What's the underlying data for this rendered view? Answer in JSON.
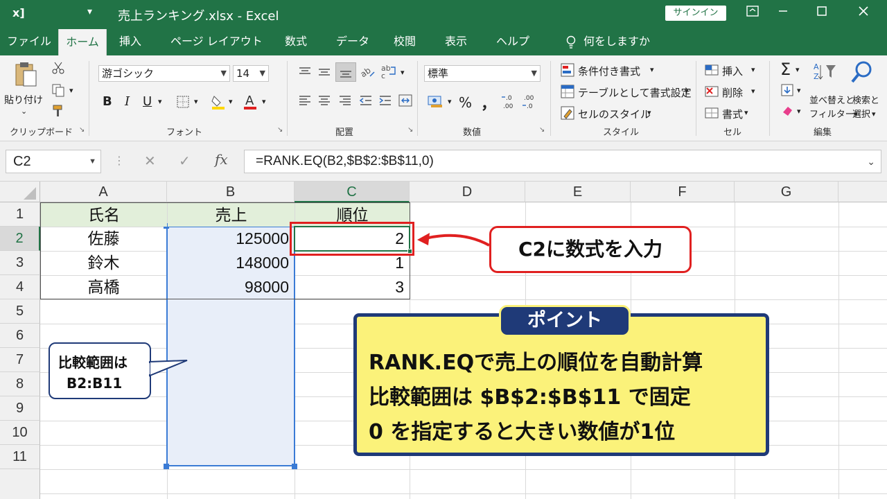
{
  "window": {
    "title": "売上ランキング.xlsx - Excel",
    "signin": "サインイン",
    "qat_glyph": "▾",
    "logo": "x]"
  },
  "tabs": [
    "ファイル",
    "ホーム",
    "挿入",
    "ページ レイアウト",
    "数式",
    "データ",
    "校閲",
    "表示",
    "ヘルプ"
  ],
  "tell_me": "何をしますか",
  "ribbon": {
    "clipboard": {
      "paste": "貼り付け",
      "label": "クリップボード"
    },
    "font": {
      "name": "游ゴシック",
      "size": "14",
      "bold": "B",
      "italic": "I",
      "underline": "U",
      "label": "フォント"
    },
    "alignment": {
      "label": "配置"
    },
    "number": {
      "format": "標準",
      "percent": "%",
      "comma": "，",
      "label": "数値"
    },
    "styles": {
      "conditional": "条件付き書式",
      "table": "テーブルとして書式設定",
      "cell_styles": "セルのスタイル",
      "label": "スタイル"
    },
    "cells": {
      "insert": "挿入",
      "delete": "削除",
      "format": "書式",
      "label": "セル"
    },
    "editing": {
      "sort": "並べ替えと\nフィルター",
      "sort1": "並べ替えと",
      "sort2": "フィルター",
      "find1": "検索と",
      "find2": "選択",
      "label": "編集"
    }
  },
  "formula_bar": {
    "name_box": "C2",
    "cancel": "✕",
    "enter": "✓",
    "fx": "fx",
    "formula": "=RANK.EQ(B2,$B$2:$B$11,0)"
  },
  "columns": [
    "A",
    "B",
    "C",
    "D",
    "E",
    "F",
    "G"
  ],
  "rows": [
    "1",
    "2",
    "3",
    "4",
    "5",
    "6",
    "7",
    "8",
    "9",
    "10",
    "11"
  ],
  "table": {
    "headers": [
      "氏名",
      "売上",
      "順位"
    ],
    "rows": [
      [
        "佐藤",
        "125000",
        "2"
      ],
      [
        "鈴木",
        "148000",
        "1"
      ],
      [
        "高橋",
        "98000",
        "3"
      ]
    ]
  },
  "annotations": {
    "callout": "C2に数式を入力",
    "bubble_line1": "比較範囲は",
    "bubble_line2": "B2:B11",
    "point_title": "ポイント",
    "point_lines": [
      "RANK.EQで売上の順位を自動計算",
      "比較範囲は $B$2:$B$11 で固定",
      "0 を指定すると大きい数値が1位"
    ]
  },
  "colors": {
    "excel_green": "#217346",
    "header_fill": "#e2efda",
    "range_fill": "#e8eef9",
    "range_border": "#3a7bd5",
    "callout_red": "#e02020",
    "point_yellow": "#fbf27a",
    "point_navy": "#1f3a78"
  }
}
